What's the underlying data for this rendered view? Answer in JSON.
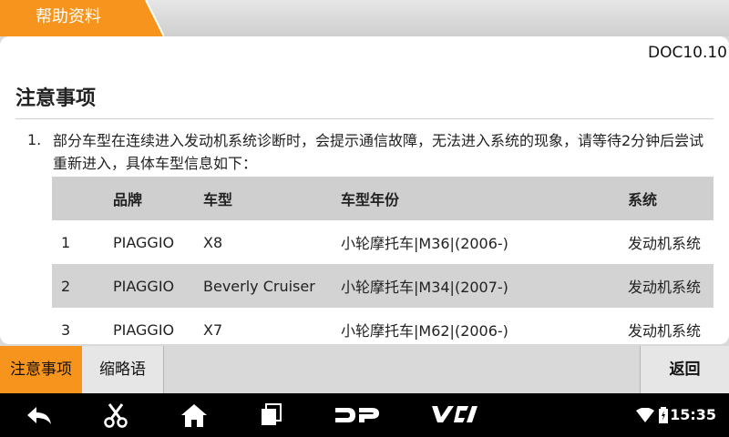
{
  "header": {
    "title": "帮助资料"
  },
  "doc": {
    "version": "DOC10.10",
    "title": "注意事项",
    "note_number": "1.",
    "note_text": "部分车型在连续进入发动机系统诊断时，会提示通信故障，无法进入系统的现象，请等待2分钟后尝试重新进入，具体车型信息如下："
  },
  "table": {
    "headers": [
      "",
      "品牌",
      "车型",
      "车型年份",
      "系统"
    ],
    "rows": [
      [
        "1",
        "PIAGGIO",
        "X8",
        "小轮摩托车|M36|(2006-)",
        "发动机系统"
      ],
      [
        "2",
        "PIAGGIO",
        "Beverly Cruiser",
        "小轮摩托车|M34|(2007-)",
        "发动机系统"
      ],
      [
        "3",
        "PIAGGIO",
        "X7",
        "小轮摩托车|M62|(2006-)",
        "发动机系统"
      ]
    ]
  },
  "tabs": {
    "notes": "注意事项",
    "abbr": "缩略语",
    "back": "返回"
  },
  "navbar": {
    "icons": [
      "back-arrow-icon",
      "scissors-icon",
      "home-icon",
      "recent-apps-icon",
      "dp-logo-icon",
      "vci-logo-icon"
    ],
    "time": "15:35"
  },
  "colors": {
    "accent": "#f7941d"
  }
}
